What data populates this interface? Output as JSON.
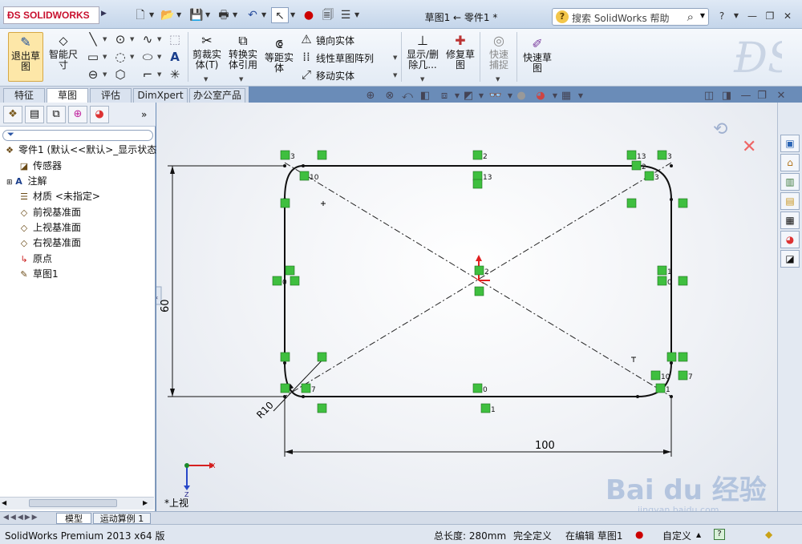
{
  "app": {
    "logo_text": "SOLIDWORKS",
    "document_title": "草图1 ← 零件1 *",
    "help_search_placeholder": "搜索 SolidWorks 帮助"
  },
  "ribbon": {
    "exit_sketch": "退出草图",
    "smart_dimension": "智能尺寸",
    "trim_entities": "剪裁实体(T)",
    "convert_entities": "转换实体引用",
    "offset_entities": "等距实体",
    "mirror_entities": "镜向实体",
    "linear_pattern": "线性草图阵列",
    "move_entities": "移动实体",
    "display_delete_relations": "显示/删除几...",
    "repair_sketch": "修复草图",
    "quick_snaps": "快速捕捉",
    "rapid_sketch": "快速草图"
  },
  "tabs": [
    "特征",
    "草图",
    "评估",
    "DimXpert",
    "办公室产品"
  ],
  "active_tab": 1,
  "tree": {
    "root": "零件1 (默认<<默认>_显示状态",
    "items": [
      "传感器",
      "注解",
      "材质 <未指定>",
      "前视基准面",
      "上视基准面",
      "右视基准面",
      "原点",
      "草图1"
    ]
  },
  "sketch": {
    "dim_width": "100",
    "dim_height": "60",
    "dim_radius": "R10",
    "view_label": "*上视",
    "triad_x": "X",
    "triad_z": "Z",
    "relation_labels": [
      "3",
      "2",
      "13",
      "3",
      "10",
      "13",
      "2",
      "3",
      "0",
      "2",
      "1",
      "0",
      "7",
      "10",
      "7",
      "1",
      "0",
      "1"
    ]
  },
  "bottom_tabs": [
    "模型",
    "运动算例 1"
  ],
  "status": {
    "product": "SolidWorks Premium 2013 x64 版",
    "total_length": "总长度: 280mm",
    "definition": "完全定义",
    "editing": "在编辑 草图1",
    "units": "自定义"
  },
  "watermark": {
    "brand": "Bai du 经验",
    "url": "jingyan.baidu.com"
  },
  "colors": {
    "relation_green": "#3fbf3f",
    "sketch_black": "#101010",
    "origin_red": "#e02020"
  }
}
